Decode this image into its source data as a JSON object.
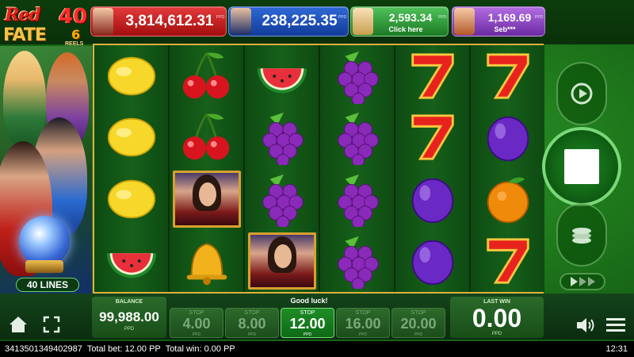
{
  "logo": {
    "line1": "Red",
    "line2": "FATE",
    "num": "40",
    "sub": "6",
    "reels": "REELS"
  },
  "jackpots": [
    {
      "value": "3,814,612.31",
      "sub": "",
      "color": "#c41818"
    },
    {
      "value": "238,225.35",
      "sub": "",
      "color": "#1c4fb8"
    },
    {
      "value": "2,593.34",
      "sub": "Click here",
      "color": "#2e9a38"
    },
    {
      "value": "1,169.69",
      "sub": "Seb***",
      "color": "#9048c4"
    }
  ],
  "currency_tag": "PPD",
  "lines_label": "40 LINES",
  "reels": [
    [
      "lemon",
      "lemon",
      "lemon",
      "watermelon"
    ],
    [
      "cherry",
      "cherry",
      "lady",
      "bell"
    ],
    [
      "watermelon",
      "grapes",
      "grapes",
      "lady"
    ],
    [
      "grapes",
      "grapes",
      "grapes",
      "grapes"
    ],
    [
      "seven",
      "seven",
      "plum",
      "plum"
    ],
    [
      "seven",
      "plum",
      "orange",
      "seven"
    ]
  ],
  "balance": {
    "label": "BALANCE",
    "amount": "99,988.00",
    "currency": "PPD"
  },
  "message": "Good luck!",
  "bets": [
    {
      "label": "STOP",
      "value": "4.00",
      "currency": "PPD",
      "active": false
    },
    {
      "label": "STOP",
      "value": "8.00",
      "currency": "PPD",
      "active": false
    },
    {
      "label": "STOP",
      "value": "12.00",
      "currency": "PPD",
      "active": true
    },
    {
      "label": "STOP",
      "value": "16.00",
      "currency": "PPD",
      "active": false
    },
    {
      "label": "STOP",
      "value": "20.00",
      "currency": "PPD",
      "active": false
    }
  ],
  "last_win": {
    "label": "LAST WIN",
    "amount": "0.00",
    "currency": "PPD"
  },
  "status": {
    "id": "3413501349402987",
    "total_bet": "Total bet: 12.00 PP",
    "total_win": "Total win: 0.00 PP",
    "clock": "12:31"
  },
  "icons": {
    "home": "home-icon",
    "fullscreen": "fullscreen-icon",
    "autoplay": "autoplay-icon",
    "stop": "stop-icon",
    "coins": "coins-icon",
    "turbo": "turbo-icon",
    "sound": "sound-icon",
    "menu": "menu-icon"
  }
}
